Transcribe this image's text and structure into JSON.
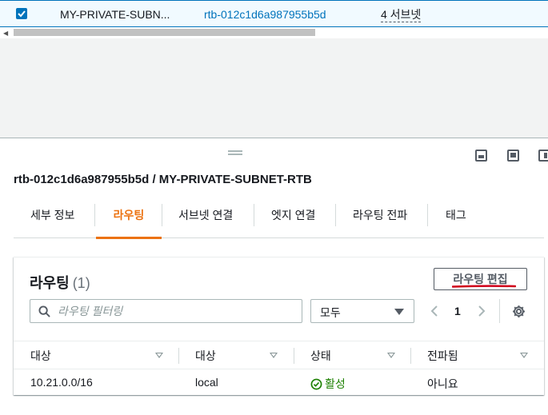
{
  "top_row": {
    "name": "MY-PRIVATE-SUBN...",
    "route_table_id": "rtb-012c1d6a987955b5d",
    "subnets": "4 서브넷"
  },
  "panel": {
    "title": "rtb-012c1d6a987955b5d / MY-PRIVATE-SUBNET-RTB",
    "tabs": [
      {
        "label": "세부 정보"
      },
      {
        "label": "라우팅",
        "active": true
      },
      {
        "label": "서브넷 연결"
      },
      {
        "label": "엣지 연결"
      },
      {
        "label": "라우팅 전파"
      },
      {
        "label": "태그"
      }
    ]
  },
  "routes": {
    "title": "라우팅",
    "count": "(1)",
    "edit_button": "라우팅 편집",
    "filter_placeholder": "라우팅 필터링",
    "select_value": "모두",
    "page": "1",
    "columns": [
      "대상",
      "대상",
      "상태",
      "전파됨"
    ],
    "rows": [
      {
        "destination": "10.21.0.0/16",
        "target": "local",
        "status": "활성",
        "propagated": "아니요"
      }
    ]
  },
  "colors": {
    "accent": "#ec7211",
    "link": "#0073bb",
    "success": "#1d8102",
    "annotation": "#d0021b"
  }
}
